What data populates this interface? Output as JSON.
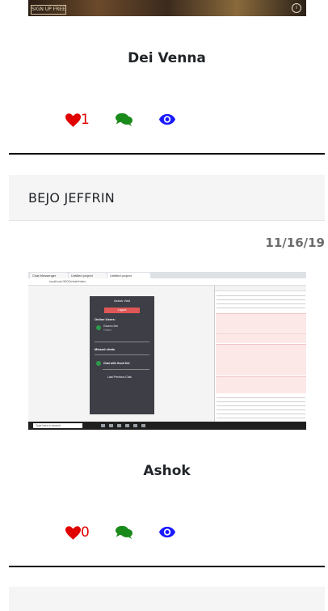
{
  "post1": {
    "image_badge": "SIGN UP FREE",
    "author": "Dei Venna",
    "likes": "1"
  },
  "post2": {
    "header": "BEJO JEFFRIN",
    "date": "11/16/19",
    "author": "Ashok",
    "likes": "0",
    "screenshot": {
      "tab1": "Chat Messenger",
      "tab2": "Untitled project",
      "tab3": "Untitled project",
      "address": "localhost:3000/chat/index",
      "app_title": "Ashok Visit",
      "logout": "Logout",
      "online_users": "Online Users:",
      "online_user_name": "Gouri a Dei",
      "online_user_status": "Online",
      "missed_chats": "Missed chats",
      "chat_button": "Chat with Gouri Dei",
      "last_chat": "Last Previous Chat",
      "search_placeholder": "Type here to search"
    }
  },
  "icons": {
    "like": "heart-icon",
    "comment": "comments-icon",
    "view": "eye-icon"
  },
  "colors": {
    "like": "#e00000",
    "comment": "#1a8a1a",
    "view": "#1a1aff",
    "header_bg": "#f5f5f5"
  }
}
